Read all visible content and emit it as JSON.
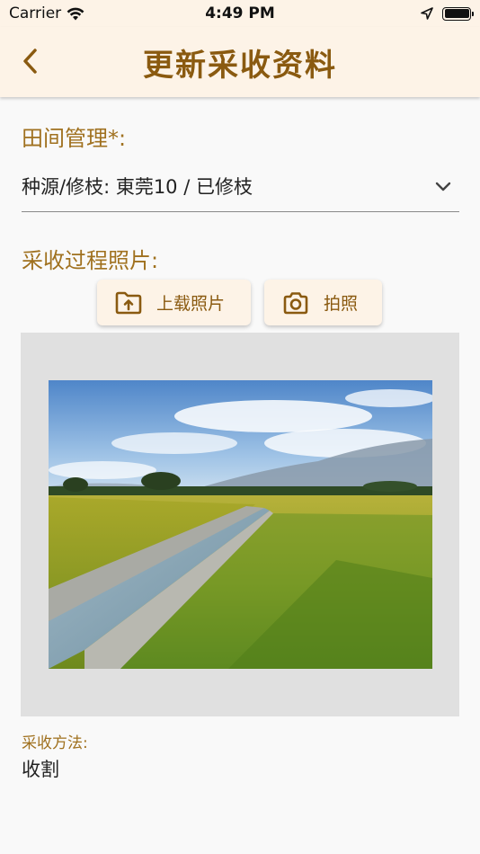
{
  "status": {
    "carrier": "Carrier",
    "time": "4:49 PM"
  },
  "nav": {
    "title": "更新采收资料",
    "back_icon": "chevron-left-icon"
  },
  "field_management": {
    "label": "田间管理*:",
    "value": "种源/修枝: 東莞10 / 已修枝"
  },
  "harvest_photos": {
    "label": "采收过程照片:",
    "upload_label": "上载照片",
    "camera_label": "拍照"
  },
  "harvest_method": {
    "label": "采收方法:",
    "value": "收割"
  },
  "colors": {
    "accent": "#8a5a10",
    "label": "#a0711f",
    "header_bg": "#fdf3e7"
  }
}
